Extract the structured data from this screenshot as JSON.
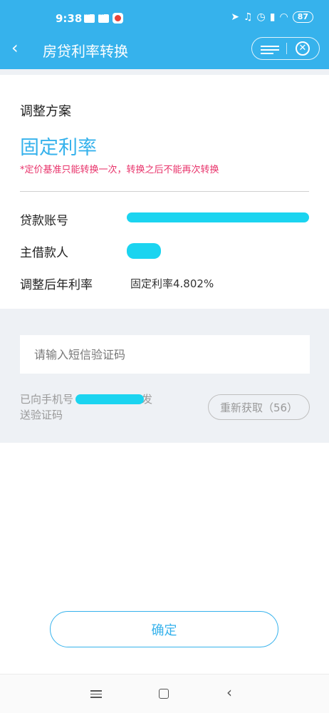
{
  "status_bar": {
    "time": "9:38",
    "battery": "87",
    "icons": [
      "chat-icon",
      "chat-icon",
      "weibo-icon",
      "location-icon",
      "mute-icon",
      "alarm-icon",
      "signal-icon",
      "wifi-icon",
      "battery-icon"
    ]
  },
  "header": {
    "title": "房贷利率转换",
    "back_icon": "chevron-left-icon",
    "menu_icon": "menu-icon",
    "close_icon": "close-circle-icon",
    "accent_color": "#36b2ec"
  },
  "plan": {
    "label": "调整方案",
    "value": "固定利率",
    "note": "*定价基准只能转换一次，转换之后不能再次转换",
    "note_color": "#e8326a"
  },
  "rows": [
    {
      "label": "贷款账号",
      "value": ""
    },
    {
      "label": "主借款人",
      "value": ""
    },
    {
      "label": "调整后年利率",
      "value": "固定利率4.802%"
    }
  ],
  "sms": {
    "placeholder": "请输入短信验证码",
    "sent_prefix": "已向手机号",
    "sent_suffix": "发送验证码",
    "resend_label": "重新获取（56）"
  },
  "confirm_label": "确定",
  "redact_color": "#1bd4f0"
}
